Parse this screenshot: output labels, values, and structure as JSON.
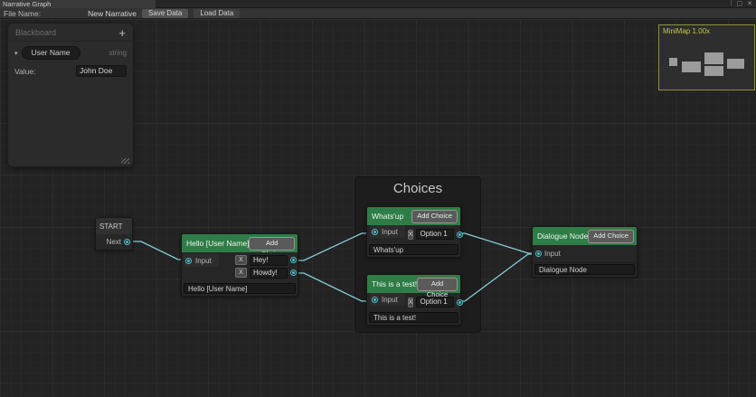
{
  "window": {
    "title": "Narrative Graph",
    "menu_icon": "⁞",
    "maximize_icon": "▢",
    "close_icon": "✕"
  },
  "toolbar": {
    "file_name_label": "File Name:",
    "file_name_value": "New Narrative",
    "save_button": "Save Data",
    "load_button": "Load Data"
  },
  "blackboard": {
    "title": "Blackboard",
    "add_icon": "+",
    "chevron_icon": "▾",
    "property_name": "User Name",
    "property_type": "string",
    "value_label": "Value:",
    "value": "John Doe"
  },
  "minimap": {
    "title": "MiniMap  1.00x"
  },
  "group": {
    "title": "Choices"
  },
  "nodes": {
    "start": {
      "title": "START",
      "output_label": "Next"
    },
    "hello": {
      "title": "Hello [User Name]",
      "add_choice": "Add Choice",
      "input_label": "Input",
      "remove": "X",
      "choice1": "Hey!",
      "choice2": "Howdy!",
      "text": "Hello [User Name]"
    },
    "whatsup": {
      "title": "Whats'up",
      "add_choice": "Add Choice",
      "input_label": "Input",
      "remove": "X",
      "choice1": "Option 1",
      "text": "Whats'up"
    },
    "test": {
      "title": "This is a test!",
      "add_choice": "Add Choice",
      "input_label": "Input",
      "remove": "X",
      "choice1": "Option 1",
      "text": "This is a test!"
    },
    "dialogue": {
      "title": "Dialogue Node",
      "add_choice": "Add Choice",
      "input_label": "Input",
      "text": "Dialogue Node"
    }
  },
  "colors": {
    "node_header_green": "#2e7d46",
    "edge": "#86ced8",
    "port": "#4fc1cc",
    "minimap_accent": "#c6c646",
    "canvas_bg": "#232323"
  }
}
